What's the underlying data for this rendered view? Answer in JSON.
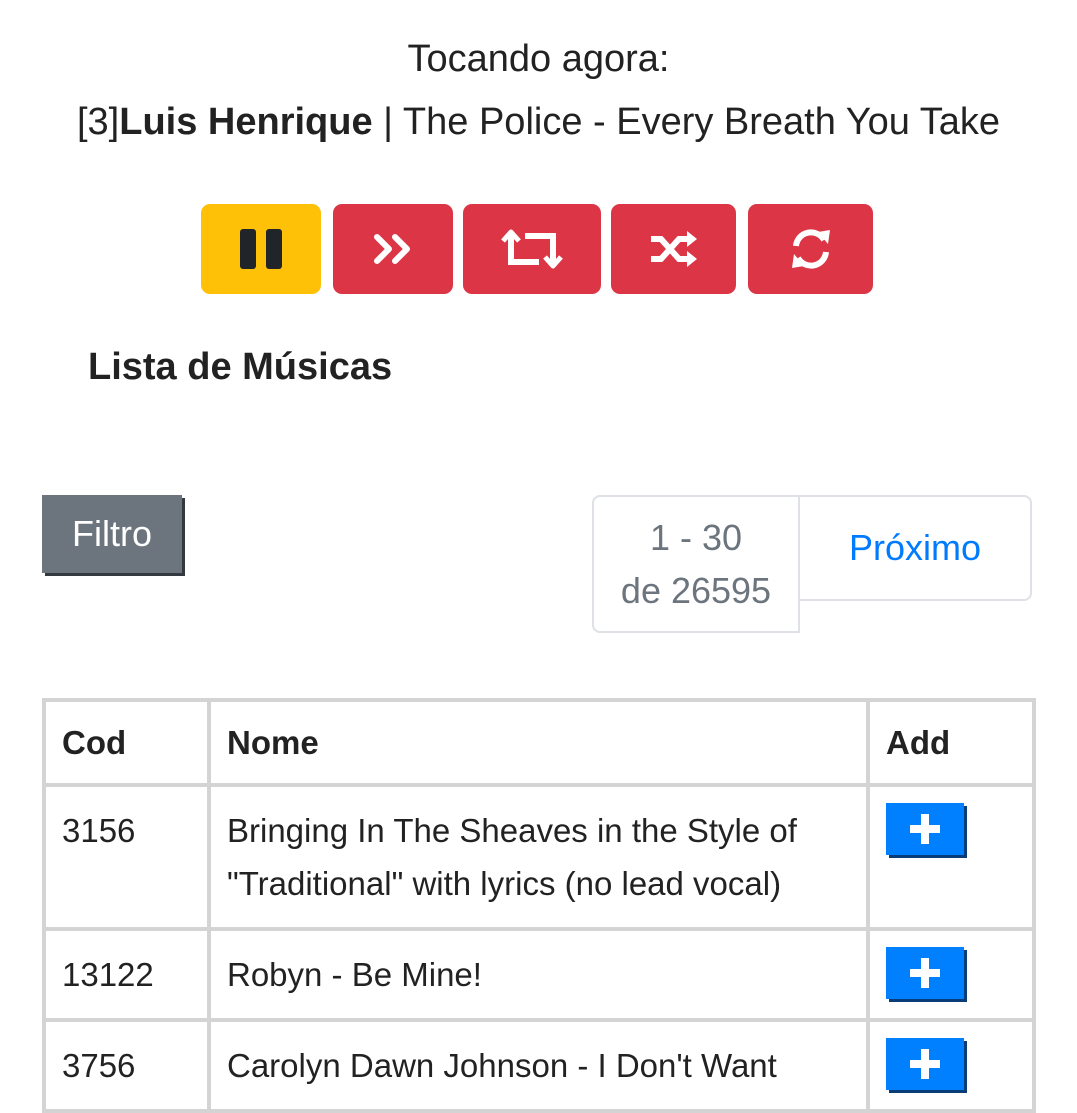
{
  "now_playing": {
    "label": "Tocando agora:",
    "queue_position": "[3]",
    "user": "Luis Henrique",
    "separator": " | ",
    "track": "The Police - Every Breath You Take"
  },
  "controls": [
    {
      "name": "pause-button",
      "icon": "pause-icon",
      "style": "warning",
      "color": "#ffc107"
    },
    {
      "name": "next-button",
      "icon": "double-chevron-right-icon",
      "style": "danger",
      "color": "#dc3545"
    },
    {
      "name": "repeat-button",
      "icon": "repeat-icon",
      "style": "danger",
      "color": "#dc3545"
    },
    {
      "name": "shuffle-button",
      "icon": "shuffle-icon",
      "style": "danger",
      "color": "#dc3545"
    },
    {
      "name": "refresh-button",
      "icon": "refresh-icon",
      "style": "danger",
      "color": "#dc3545"
    }
  ],
  "section_title": "Lista de Músicas",
  "filter": {
    "label": "Filtro"
  },
  "pagination": {
    "range": "1 - 30",
    "total": "de 26595",
    "next_label": "Próximo"
  },
  "table": {
    "headers": [
      "Cod",
      "Nome",
      "Add"
    ],
    "rows": [
      {
        "cod": "3156",
        "nome": "Bringing In The Sheaves in the Style of \"Traditional\" with lyrics (no lead vocal)",
        "add": "+"
      },
      {
        "cod": "13122",
        "nome": "Robyn - Be Mine!",
        "add": "+"
      },
      {
        "cod": "3756",
        "nome": "Carolyn Dawn Johnson - I Don't Want",
        "add": "+"
      }
    ]
  },
  "colors": {
    "accent_blue": "#007bff",
    "add_button": "#0080ff",
    "secondary": "#6c757d"
  }
}
